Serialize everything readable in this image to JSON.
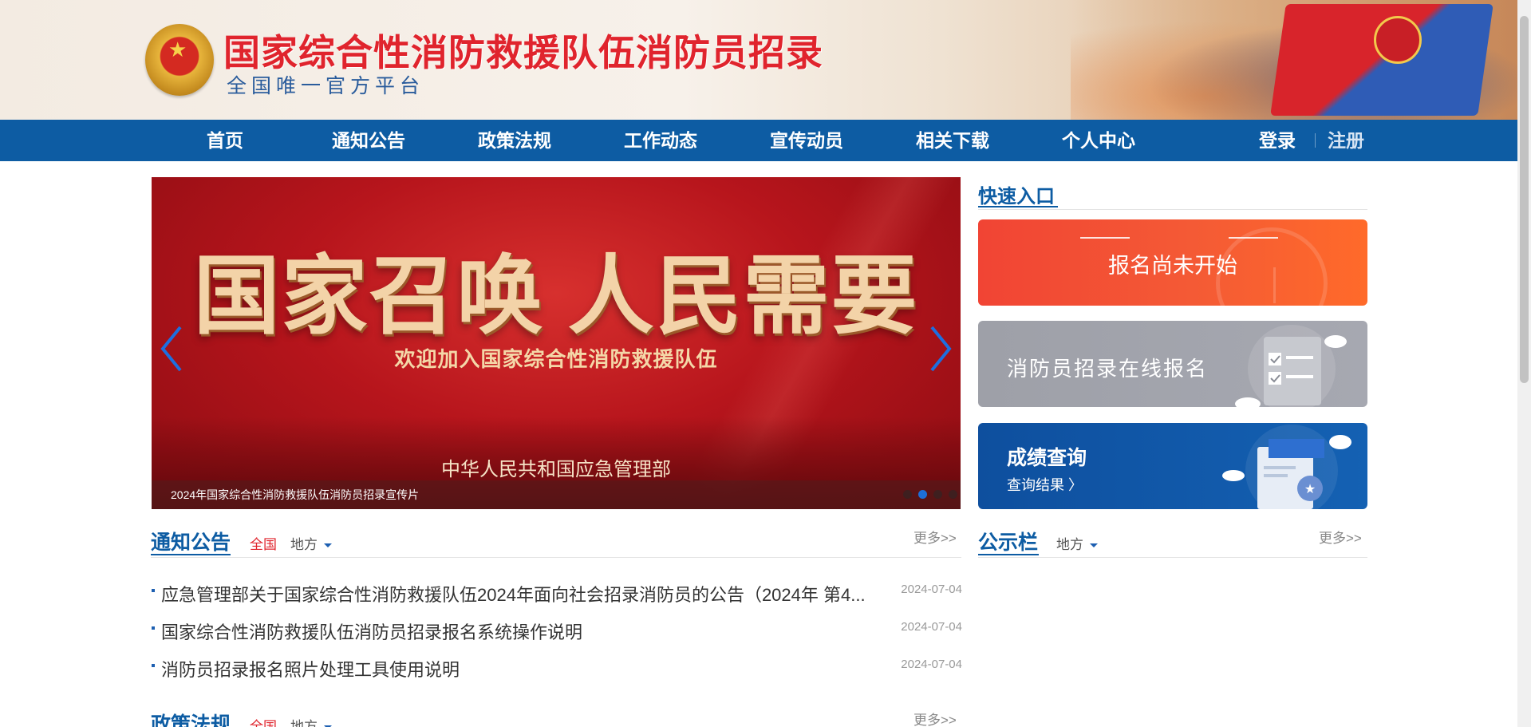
{
  "header": {
    "title": "国家综合性消防救援队伍消防员招录",
    "subtitle": "全国唯一官方平台"
  },
  "nav": {
    "items": [
      "首页",
      "通知公告",
      "政策法规",
      "工作动态",
      "宣传动员",
      "相关下载",
      "个人中心"
    ],
    "login": "登录",
    "register": "注册"
  },
  "carousel": {
    "headline": "国家召唤 人民需要",
    "tagline": "欢迎加入国家综合性消防救援队伍",
    "organization": "中华人民共和国应急管理部",
    "caption": "2024年国家综合性消防救援队伍消防员招录宣传片",
    "slide_count": 4,
    "active_slide": 2
  },
  "quick_entry": {
    "title": "快速入口",
    "register_status": "报名尚未开始",
    "online_register": "消防员招录在线报名",
    "score_query": "成绩查询",
    "score_query_sub": "查询结果 〉"
  },
  "notices": {
    "title": "通知公告",
    "tab_national": "全国",
    "tab_local": "地方",
    "more": "更多>>",
    "items": [
      {
        "title": "应急管理部关于国家综合性消防救援队伍2024年面向社会招录消防员的公告（2024年 第4...",
        "date": "2024-07-04"
      },
      {
        "title": "国家综合性消防救援队伍消防员招录报名系统操作说明",
        "date": "2024-07-04"
      },
      {
        "title": "消防员招录报名照片处理工具使用说明",
        "date": "2024-07-04"
      }
    ]
  },
  "bulletin": {
    "title": "公示栏",
    "tab_local": "地方",
    "more": "更多>>"
  },
  "policy": {
    "title": "政策法规",
    "tab_national": "全国",
    "tab_local": "地方",
    "more": "更多>>"
  },
  "colors": {
    "nav_blue": "#0d5ca3",
    "title_red": "#e0242d",
    "card_red": "#f14434",
    "card_grey": "#a2a4ac",
    "card_blue": "#0e4f9e"
  }
}
